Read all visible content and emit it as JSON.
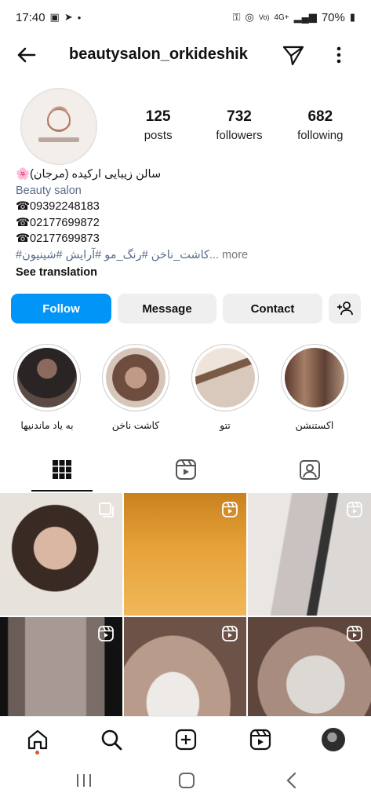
{
  "status": {
    "time": "17:40",
    "battery": "70%",
    "network": "4G+"
  },
  "header": {
    "username": "beautysalon_orkideshik"
  },
  "profile": {
    "stats": [
      {
        "value": "125",
        "label": "posts"
      },
      {
        "value": "732",
        "label": "followers"
      },
      {
        "value": "682",
        "label": "following"
      }
    ],
    "bio": {
      "name": "🌸سالن زیبایی ارکیده (مرجان)",
      "category": "Beauty salon",
      "phones": [
        "☎09392248183",
        "☎02177699872",
        "☎02177699873"
      ],
      "tags": "#کاشت_ناخن #رنگ_مو #آرایش #شینیون...",
      "more": "more",
      "see_translation": "See translation"
    }
  },
  "buttons": {
    "follow": "Follow",
    "message": "Message",
    "contact": "Contact"
  },
  "highlights": [
    {
      "label": "به یاد ماندنیها"
    },
    {
      "label": "کاشت ناخن"
    },
    {
      "label": "تتو"
    },
    {
      "label": "اکستنشن"
    }
  ],
  "tabs": {
    "active": "grid"
  },
  "colors": {
    "accent": "#0095f6",
    "link": "#5a6b8a"
  }
}
